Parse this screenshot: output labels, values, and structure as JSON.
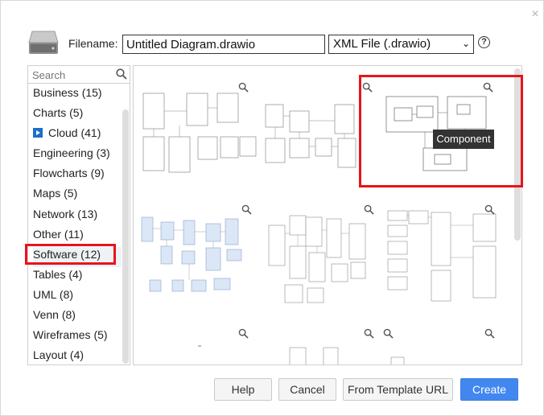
{
  "dialog": {
    "filename_label": "Filename:",
    "filename_value": "Untitled Diagram.drawio",
    "format_selected": "XML File (.drawio)"
  },
  "sidebar": {
    "search_placeholder": "Search",
    "categories": [
      {
        "label": "Business (15)"
      },
      {
        "label": "Charts (5)"
      },
      {
        "label": "Cloud (41)"
      },
      {
        "label": "Engineering (3)"
      },
      {
        "label": "Flowcharts (9)"
      },
      {
        "label": "Maps (5)"
      },
      {
        "label": "Network (13)"
      },
      {
        "label": "Other (11)"
      },
      {
        "label": "Software (12)"
      },
      {
        "label": "Tables (4)"
      },
      {
        "label": "UML (8)"
      },
      {
        "label": "Venn (8)"
      },
      {
        "label": "Wireframes (5)"
      },
      {
        "label": "Layout (4)"
      }
    ],
    "selected": "Software (12)"
  },
  "tooltip": {
    "text": "Component"
  },
  "buttons": {
    "help": "Help",
    "cancel": "Cancel",
    "from_url": "From Template URL",
    "create": "Create"
  },
  "colors": {
    "highlight": "#e8141a",
    "primary": "#4287f0"
  }
}
